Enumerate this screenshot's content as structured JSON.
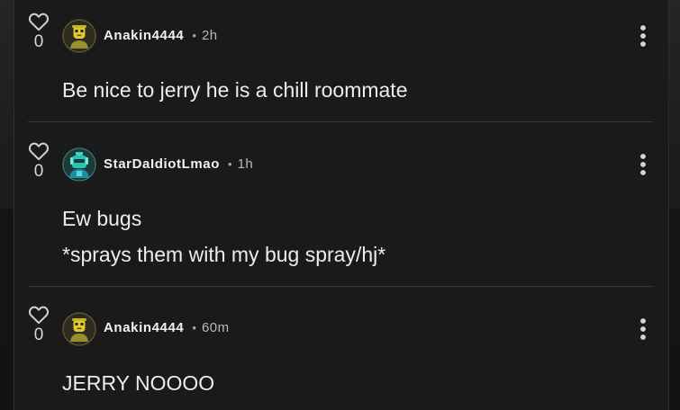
{
  "comments": [
    {
      "likes": "0",
      "username": "Anakin4444",
      "separator": "•",
      "time": "2h",
      "lines": [
        "Be nice to jerry he is a chill roommate"
      ],
      "avatar_icon": "yellow-character-avatar"
    },
    {
      "likes": "0",
      "username": "StarDaIdiotLmao",
      "separator": "•",
      "time": "1h",
      "lines": [
        "Ew bugs",
        "*sprays them with my bug spray/hj*"
      ],
      "avatar_icon": "teal-character-avatar"
    },
    {
      "likes": "0",
      "username": "Anakin4444",
      "separator": "•",
      "time": "60m",
      "lines": [
        "JERRY NOOOO"
      ],
      "avatar_icon": "yellow-character-avatar"
    }
  ],
  "icons": {
    "like": "heart-outline-icon",
    "menu": "more-vertical-icon"
  },
  "colors": {
    "background": "#1a1a1a",
    "text": "#ececec",
    "muted": "#b9b9b9",
    "divider": "#3a3a3a",
    "avatar_yellow": "#d9c62a",
    "avatar_teal": "#2fb9a8"
  }
}
